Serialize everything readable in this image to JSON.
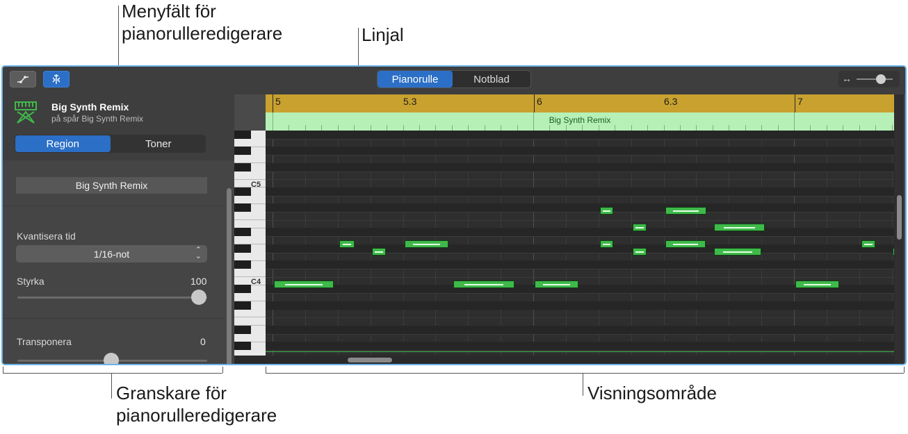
{
  "callouts": {
    "menubar_line1": "Menyfält för",
    "menubar_line2": "pianorulleredigerare",
    "ruler": "Linjal",
    "inspector_line1": "Granskare för",
    "inspector_line2": "pianorulleredigerare",
    "display_area": "Visningsområde"
  },
  "menubar": {
    "view_tabs": [
      "Pianorulle",
      "Notblad"
    ],
    "active_view": "Pianorulle",
    "automation_icon": "automation-curve-icon",
    "snap_icon": "smart-controls-icon",
    "zoom_icon": "horizontal-zoom-icon"
  },
  "inspector": {
    "region_name": "Big Synth Remix",
    "track_subtitle": "på spår Big Synth Remix",
    "tabs": [
      "Region",
      "Toner"
    ],
    "active_tab": "Region",
    "name_field": "Big Synth Remix",
    "quantize_label": "Kvantisera tid",
    "quantize_value": "1/16-not",
    "velocity_label": "Styrka",
    "velocity_value": "100",
    "transpose_label": "Transponera",
    "transpose_value": "0"
  },
  "ruler": {
    "labels": [
      "5",
      "5.3",
      "6",
      "6.3",
      "7"
    ]
  },
  "region_bar": {
    "name": "Big Synth Remix"
  },
  "keyboard": {
    "labels": [
      "C5",
      "C4"
    ]
  },
  "colors": {
    "accent": "#2c6fc6",
    "ruler": "#c9a12f",
    "region": "#b7f0b6",
    "note": "#3fb94a",
    "frame": "#6bb3e8"
  }
}
